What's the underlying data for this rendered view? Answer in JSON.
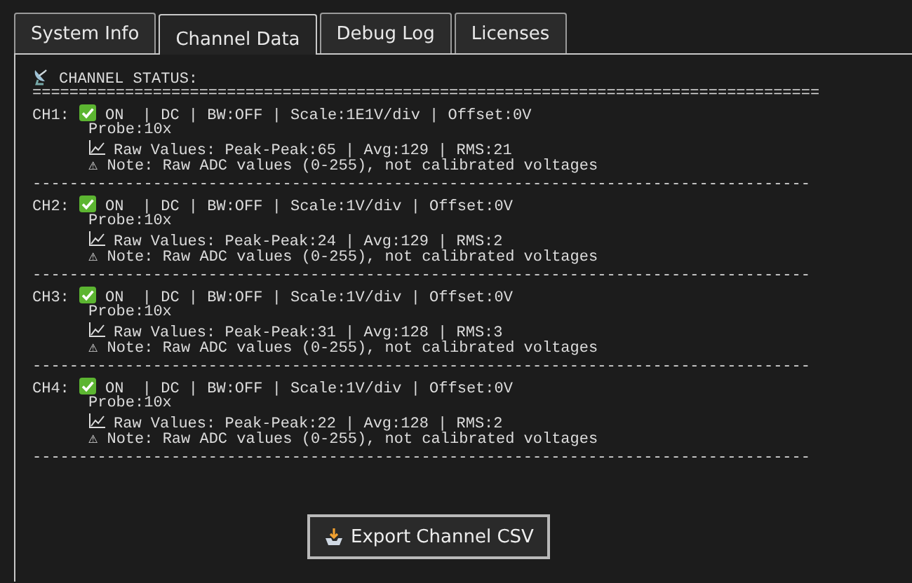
{
  "tabs": [
    {
      "label": "System Info",
      "selected": false
    },
    {
      "label": "Channel Data",
      "selected": true
    },
    {
      "label": "Debug Log",
      "selected": false
    },
    {
      "label": "Licenses",
      "selected": false
    }
  ],
  "log": {
    "header": "CHANNEL STATUS:",
    "header_rule": "=====================================================================================",
    "channels": [
      {
        "label": "CH1:",
        "status": "ON  | DC | BW:OFF | Scale:1E1V/div | Offset:0V",
        "probe": "Probe:10x",
        "raw": "Raw Values: Peak-Peak:65 | Avg:129 | RMS:21",
        "note": "⚠ Note: Raw ADC values (0-255), not calibrated voltages",
        "rule": "------------------------------------------------------------------------------------"
      },
      {
        "label": "CH2:",
        "status": "ON  | DC | BW:OFF | Scale:1V/div | Offset:0V",
        "probe": "Probe:10x",
        "raw": "Raw Values: Peak-Peak:24 | Avg:129 | RMS:2",
        "note": "⚠ Note: Raw ADC values (0-255), not calibrated voltages",
        "rule": "------------------------------------------------------------------------------------"
      },
      {
        "label": "CH3:",
        "status": "ON  | DC | BW:OFF | Scale:1V/div | Offset:0V",
        "probe": "Probe:10x",
        "raw": "Raw Values: Peak-Peak:31 | Avg:128 | RMS:3",
        "note": "⚠ Note: Raw ADC values (0-255), not calibrated voltages",
        "rule": "------------------------------------------------------------------------------------"
      },
      {
        "label": "CH4:",
        "status": "ON  | DC | BW:OFF | Scale:1V/div | Offset:0V",
        "probe": "Probe:10x",
        "raw": "Raw Values: Peak-Peak:22 | Avg:128 | RMS:2",
        "note": "⚠ Note: Raw ADC values (0-255), not calibrated voltages",
        "rule": "------------------------------------------------------------------------------------"
      }
    ]
  },
  "export_button": "Export Channel CSV"
}
